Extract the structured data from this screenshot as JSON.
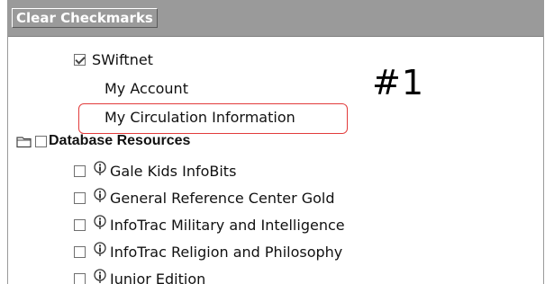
{
  "header": {
    "clear_label": "Clear Checkmarks"
  },
  "swiftnet": {
    "label": "SWiftnet",
    "checked": true,
    "children": [
      "My Account",
      "My Circulation Information"
    ]
  },
  "annotation": {
    "label": "#1",
    "color": "#e23b3b"
  },
  "database_resources": {
    "title": "Database Resources",
    "items": [
      "Gale Kids InfoBits",
      "General Reference Center Gold",
      "InfoTrac Military and Intelligence",
      "InfoTrac Religion and Philosophy",
      "Junior Edition"
    ]
  },
  "icons": {
    "folder": "folder-icon",
    "info": "info-icon",
    "checkbox": "checkbox"
  }
}
